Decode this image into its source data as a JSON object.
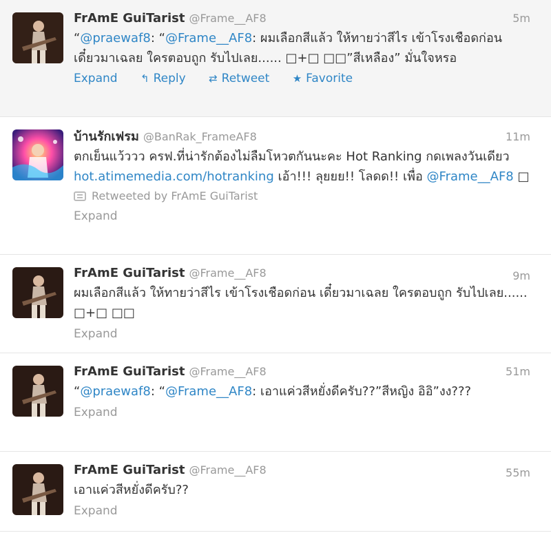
{
  "tweets": [
    {
      "fullname": "FrAmE GuiTarist",
      "username": "@Frame__AF8",
      "time": "5m",
      "text_parts": {
        "p1": "“",
        "m1": "@praewaf8",
        "p2": ": “",
        "m2": "@Frame__AF8",
        "p3": ": ผมเลือกสีแล้ว ให้ทายว่าสีไร เข้าโรงเชือดก่อน เดี๋ยวมาเฉลย ใครตอบถูก รับไปเลย...... □+□ □□”สีเหลือง” มั่นใจหรอ"
      },
      "actions": {
        "expand": "Expand",
        "reply": "Reply",
        "retweet": "Retweet",
        "favorite": "Favorite"
      }
    },
    {
      "fullname": "บ้านรักเฟรม",
      "username": "@BanRak_FrameAF8",
      "time": "11m",
      "text_parts": {
        "p1": "ตกเย็นแว้ววว ครฟ.ที่น่ารักต้องไม่ลืมโหวตกันนะคะ Hot Ranking กดเพลงวันเดียว ",
        "l1": "hot.atimemedia.com/hotranking",
        "p2": " เอ้า!!! ลุยยย!! โลดด!! เพื่อ ",
        "m1": "@Frame__AF8",
        "p3": " □"
      },
      "retweeted_by": "Retweeted by FrAmE GuiTarist",
      "expand": "Expand"
    },
    {
      "fullname": "FrAmE GuiTarist",
      "username": "@Frame__AF8",
      "time": "9m",
      "text": "ผมเลือกสีแล้ว ให้ทายว่าสีไร เข้าโรงเชือดก่อน เดี๋ยวมาเฉลย ใครตอบถูก รับไปเลย...... □+□ □□",
      "expand": "Expand"
    },
    {
      "fullname": "FrAmE GuiTarist",
      "username": "@Frame__AF8",
      "time": "51m",
      "text_parts": {
        "p1": "“",
        "m1": "@praewaf8",
        "p2": ": “",
        "m2": "@Frame__AF8",
        "p3": ": เอาแค่วสีหยั่งดีครับ??”สีหญิง อิอิ”งง???"
      },
      "expand": "Expand"
    },
    {
      "fullname": "FrAmE GuiTarist",
      "username": "@Frame__AF8",
      "time": "55m",
      "text": "เอาแค่วสีหยั่งดีครับ??",
      "expand": "Expand"
    }
  ]
}
